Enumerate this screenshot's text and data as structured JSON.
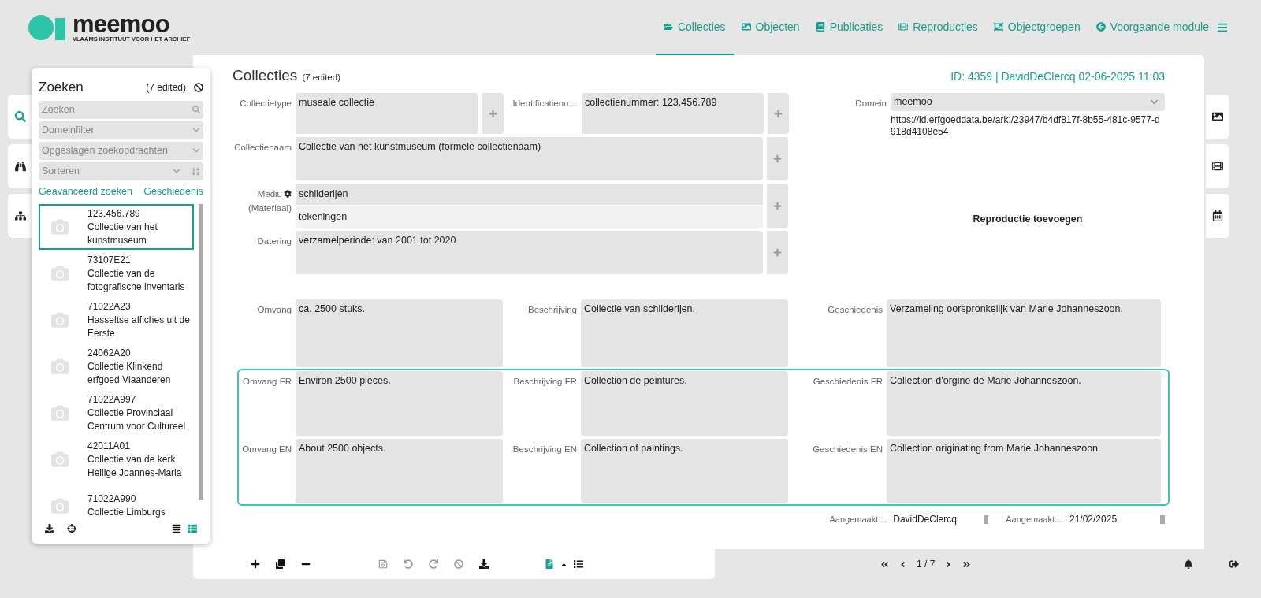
{
  "header": {
    "logo": {
      "name": "meemoo",
      "tagline": "VLAAMS INSTITUUT VOOR HET ARCHIEF"
    },
    "nav": [
      {
        "label": "Collecties",
        "selected": true
      },
      {
        "label": "Objecten",
        "selected": false
      },
      {
        "label": "Publicaties",
        "selected": false
      },
      {
        "label": "Reproducties",
        "selected": false
      },
      {
        "label": "Objectgroepen",
        "selected": false
      },
      {
        "label": "Voorgaande module",
        "selected": false
      }
    ]
  },
  "left_tabs": [
    {
      "selected": true
    },
    {
      "selected": false
    },
    {
      "selected": false
    }
  ],
  "search_panel": {
    "title": "Zoeken",
    "edited": "(7 edited)",
    "search": {
      "placeholder": "Zoeken"
    },
    "filters": [
      {
        "placeholder": "Domeinfilter",
        "kind": "select"
      },
      {
        "placeholder": "Opgeslagen zoekopdrachten",
        "kind": "select"
      },
      {
        "placeholder": "Sorteren",
        "kind": "sort"
      }
    ],
    "links": [
      "Geavanceerd zoeken",
      "Geschiedenis"
    ],
    "results": [
      {
        "id": "123.456.789",
        "title": "Collectie van het kunstmuseum",
        "selected": true
      },
      {
        "id": "73107E21",
        "title": "Collectie van de fotografische inventaris",
        "selected": false
      },
      {
        "id": "71022A23",
        "title": "Hasseltse affiches uit de Eerste",
        "selected": false
      },
      {
        "id": "24062A20",
        "title": "Collectie Klinkend erfgoed Vlaanderen",
        "selected": false
      },
      {
        "id": "71022A997",
        "title": "Collectie Provinciaal Centrum voor Cultureel",
        "selected": false
      },
      {
        "id": "42011A01",
        "title": "Collectie van de kerk Heilige Joannes-Maria",
        "selected": false
      },
      {
        "id": "71022A990",
        "title": "Collectie Limburgs",
        "selected": false
      }
    ],
    "view": [
      {
        "selected": false
      },
      {
        "selected": true
      }
    ]
  },
  "record": {
    "title": "Collecties",
    "edited": "(7 edited)",
    "meta": "ID: 4359 | DavidDeClercq 02-06-2025 11:03",
    "collectietype": {
      "label": "Collectietype",
      "value": "museale collectie"
    },
    "identificatie": {
      "label": "Identificatienu…",
      "value": "collectienummer: 123.456.789"
    },
    "naam": {
      "label": "Collectienaam",
      "value": "Collectie van het kunstmuseum (formele collectienaam)"
    },
    "medium": {
      "label": "Mediu",
      "sublabel": "(Materiaal)",
      "values": [
        "schilderijen",
        "tekeningen"
      ]
    },
    "datering": {
      "label": "Datering",
      "value": "verzamelperiode: van 2001 tot 2020"
    },
    "domein": {
      "label": "Domein",
      "value": "meemoo",
      "url": "https://id.erfgoeddata.be/ark:/23947/b4df817f-8b55-481c-9577-d918d4108e54"
    },
    "reproduction": "Reproductie toevoegen",
    "texts": [
      [
        {
          "label": "Omvang",
          "value": "ca. 2500 stuks."
        },
        {
          "label": "Beschrijving",
          "value": "Collectie van schilderijen."
        },
        {
          "label": "Geschiedenis",
          "value": "Verzameling oorspronkelijk van Marie Johanneszoon."
        }
      ]
    ],
    "translations": [
      [
        {
          "label": "Omvang FR",
          "value": "Environ 2500 pieces."
        },
        {
          "label": "Beschrijving FR",
          "value": "Collection de peintures."
        },
        {
          "label": "Geschiedenis FR",
          "value": "Collection d'orgine de Marie Johanneszoon."
        }
      ],
      [
        {
          "label": "Omvang EN",
          "value": "About 2500 objects."
        },
        {
          "label": "Beschrijving EN",
          "value": "Collection of paintings."
        },
        {
          "label": "Geschiedenis EN",
          "value": "Collection originating from Marie Johanneszoon."
        }
      ]
    ],
    "created": [
      {
        "label": "Aangemaakt…",
        "value": "DavidDeClercq"
      },
      {
        "label": "Aangemaakt…",
        "value": "21/02/2025"
      }
    ]
  },
  "toolbar": [
    {
      "disabled": false
    },
    {
      "disabled": false
    },
    {
      "disabled": false
    },
    {
      "disabled": true
    },
    {
      "disabled": true
    },
    {
      "disabled": true
    },
    {
      "disabled": true
    },
    {
      "disabled": false
    },
    {
      "disabled": false
    },
    {
      "disabled": false
    },
    {
      "disabled": false
    }
  ],
  "pager": "1 / 7"
}
